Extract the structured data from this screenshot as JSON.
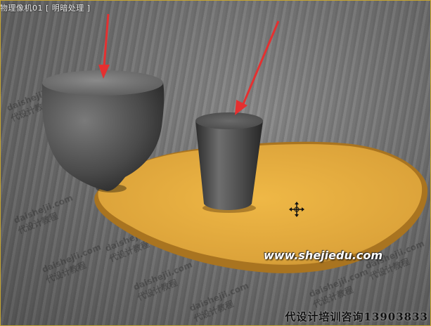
{
  "viewport": {
    "label": "物理像机01 [ 明暗处理 ]",
    "border_color": "#c8a630"
  },
  "floor_watermarks": [
    {
      "line1": "daishejii.com",
      "line2": "代设计教程"
    },
    {
      "line1": "daishejii.com",
      "line2": "代设计教程"
    },
    {
      "line1": "daishejii.com",
      "line2": "代设计教程"
    },
    {
      "line1": "daishejii.com",
      "line2": "代设计教程"
    },
    {
      "line1": "daishejii.com",
      "line2": "代设计教程"
    },
    {
      "line1": "daishejii.com",
      "line2": "代设计教程"
    },
    {
      "line1": "daishejii.com",
      "line2": "代设计教程"
    },
    {
      "line1": "daishejii.com",
      "line2": "代设计教程"
    }
  ],
  "objects": {
    "bowl": {
      "color": "#505050",
      "icon": "bowl-object"
    },
    "cup": {
      "color": "#4a4a4a",
      "icon": "cup-object"
    },
    "tray": {
      "color": "#e0a838",
      "icon": "tray-object"
    },
    "arrows": {
      "color": "#e53030"
    },
    "cursor": {
      "icon": "move-cursor-icon"
    }
  },
  "watermarks": {
    "site": "www.shejiedu.com",
    "contact": "代设计培训咨询13903833"
  }
}
